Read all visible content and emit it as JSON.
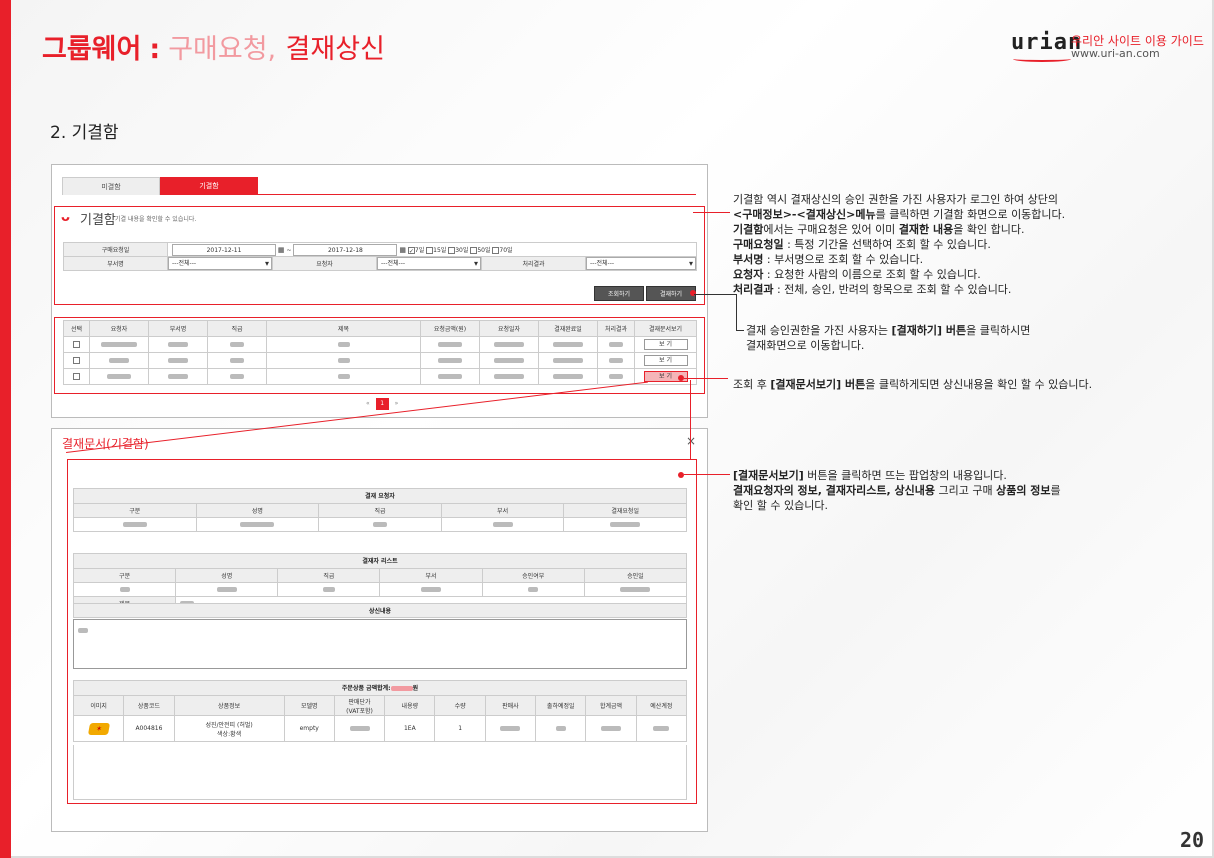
{
  "header": {
    "title": "그룹웨어",
    "sep": ":",
    "sub1": "구매요청,",
    "sub2": "결재상신"
  },
  "logo": {
    "mark": "urian",
    "line1": "우리안 사이트 이용 가이드",
    "line2": "www.uri-an.com"
  },
  "section": "2. 기결함",
  "tabs": [
    "미결함",
    "기결함"
  ],
  "search": {
    "heading": "기결함",
    "subtitle": "기결 내용을 확인할 수 있습니다.",
    "date_label": "구매요청일",
    "date_from": "2017-12-11",
    "date_sep": "~",
    "date_to": "2017-12-18",
    "ranges": [
      "7일",
      "15일",
      "30일",
      "50일",
      "70일"
    ],
    "dept_label": "부서명",
    "dept_value": "---전체---",
    "req_label": "요청자",
    "req_value": "---전체---",
    "result_label": "처리결과",
    "result_value": "---전체---",
    "search_btn": "조회하기",
    "approve_btn": "결재하기"
  },
  "list": {
    "headers": [
      "선택",
      "요청자",
      "부서명",
      "직급",
      "제목",
      "요청금액(원)",
      "요청일자",
      "결재완료일",
      "처리결과",
      "결재문서보기"
    ],
    "view_label": "보 기",
    "page": "1",
    "prev": "«",
    "next": "»"
  },
  "popup": {
    "title": "결재문서(기결함)",
    "close": "×",
    "requester_caption": "결재 요청자",
    "requester_headers": [
      "구분",
      "성명",
      "직급",
      "부서",
      "결재요청일"
    ],
    "approver_caption": "결재자 리스트",
    "approver_headers": [
      "구분",
      "성명",
      "직급",
      "부서",
      "승인여부",
      "승인일"
    ],
    "subject_label": "제목",
    "content_caption": "상신내용",
    "products_caption": "주문상품  금액합계:",
    "products_unit": "원",
    "products_headers": [
      "이미지",
      "상품코드",
      "상품정보",
      "모델명",
      "판매단가\n(VAT포함)",
      "내용량",
      "수량",
      "판매사",
      "출하예정일",
      "합계금액",
      "예산계정"
    ],
    "product": {
      "code": "A004816",
      "info1": "성진/안전띠 (허벌)",
      "info2": "색상:황색",
      "model": "empty",
      "amount": "1EA",
      "qty": "1"
    }
  },
  "annotations": {
    "a1_lines": [
      {
        "parts": [
          [
            "n",
            "기결함 역시 결재상신의 승인 권한을 가진 사용자가 로그인 하여 상단의"
          ]
        ]
      },
      {
        "parts": [
          [
            "b",
            "<구매정보>-<결재상신>메뉴"
          ],
          [
            "n",
            "를 클릭하면 기결함 화면으로 이동합니다."
          ]
        ]
      },
      {
        "parts": [
          [
            "b",
            "기결함"
          ],
          [
            "n",
            "에서는 구매요청은 있어 이미 "
          ],
          [
            "b",
            "결재한 내용"
          ],
          [
            "n",
            "을 확인 합니다."
          ]
        ]
      },
      {
        "parts": [
          [
            "b",
            "구매요청일"
          ],
          [
            "n",
            " :  특정 기간을 선택하여 조회 할 수 있습니다."
          ]
        ]
      },
      {
        "parts": [
          [
            "b",
            "부서명"
          ],
          [
            "n",
            " : 부서명으로 조회 할 수 있습니다."
          ]
        ]
      },
      {
        "parts": [
          [
            "b",
            "요청자"
          ],
          [
            "n",
            " : 요청한 사람의 이름으로 조회 할 수 있습니다."
          ]
        ]
      },
      {
        "parts": [
          [
            "b",
            "처리결과"
          ],
          [
            "n",
            " : 전체, 승인, 반려의 항목으로 조회 할 수 있습니다."
          ]
        ]
      }
    ],
    "a2_lines": [
      {
        "parts": [
          [
            "n",
            "결재 승인권한을 가진 사용자는 "
          ],
          [
            "b",
            "[결재하기] 버튼"
          ],
          [
            "n",
            "을 클릭하시면"
          ]
        ]
      },
      {
        "parts": [
          [
            "n",
            "결재화면으로 이동합니다."
          ]
        ]
      }
    ],
    "a3_lines": [
      {
        "parts": [
          [
            "n",
            "조회 후 "
          ],
          [
            "b",
            "[결재문서보기] 버튼"
          ],
          [
            "n",
            "을 클릭하게되면 상신내용을 확인 할 수 있습니다."
          ]
        ]
      }
    ],
    "a4_lines": [
      {
        "parts": [
          [
            "b",
            "[결재문서보기]"
          ],
          [
            "n",
            " 버튼을 클릭하면 뜨는 팝업창의 내용입니다."
          ]
        ]
      },
      {
        "parts": [
          [
            "b",
            "결재요청자의 정보, 결재자리스트, 상신내용"
          ],
          [
            "n",
            " 그리고 구매 "
          ],
          [
            "b",
            "상품의 정보"
          ],
          [
            "n",
            "를"
          ]
        ]
      },
      {
        "parts": [
          [
            "n",
            "확인 할 수 있습니다."
          ]
        ]
      }
    ]
  },
  "page_number": "20",
  "colors": {
    "accent": "#e8202a"
  }
}
